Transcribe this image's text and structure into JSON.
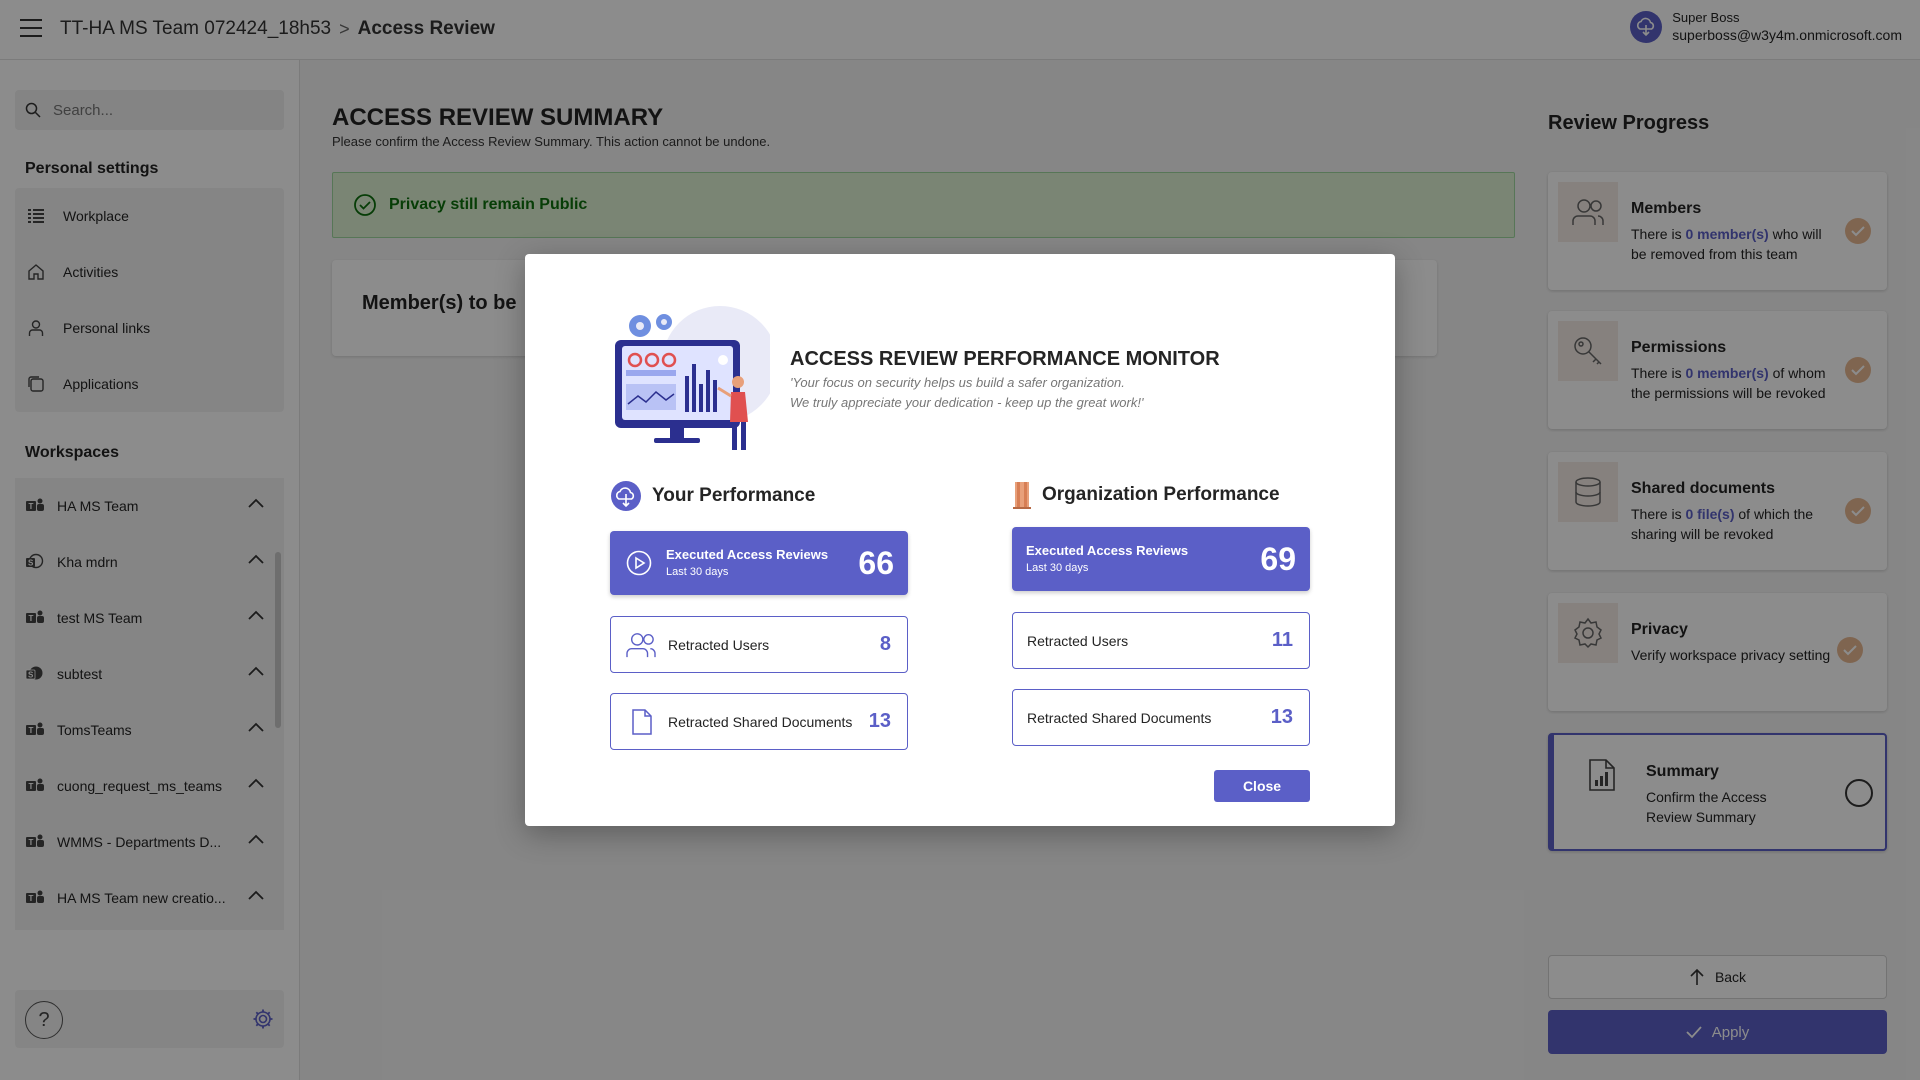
{
  "header": {
    "team_name": "TT-HA MS Team 072424_18h53",
    "separator": ">",
    "page": "Access Review",
    "user_name": "Super Boss",
    "user_email": "superboss@w3y4m.onmicrosoft.com"
  },
  "sidebar": {
    "search_placeholder": "Search...",
    "personal_title": "Personal settings",
    "personal_items": [
      {
        "label": "Workplace",
        "icon": "grid-icon"
      },
      {
        "label": "Activities",
        "icon": "home-icon"
      },
      {
        "label": "Personal links",
        "icon": "person-icon"
      },
      {
        "label": "Applications",
        "icon": "apps-icon"
      }
    ],
    "workspaces_title": "Workspaces",
    "workspaces": [
      "HA MS Team",
      "Kha mdrn",
      "test MS Team",
      "subtest",
      "TomsTeams",
      "cuong_request_ms_teams",
      "WMMS - Departments D...",
      "HA MS Team new creatio..."
    ],
    "help_label": "?"
  },
  "main": {
    "title": "ACCESS REVIEW SUMMARY",
    "subtitle": "Please confirm the Access Review Summary. This action cannot be undone.",
    "alert": "Privacy still remain Public",
    "members_title": "Member(s) to be"
  },
  "progress": {
    "title": "Review Progress",
    "steps": [
      {
        "title": "Members",
        "pre": "There is ",
        "highlight": "0 member(s)",
        "post": " who will be removed from this team"
      },
      {
        "title": "Permissions",
        "pre": "There is ",
        "highlight": "0 member(s)",
        "post": " of whom the permissions will be revoked"
      },
      {
        "title": "Shared documents",
        "pre": "There is ",
        "highlight": "0 file(s)",
        "post": " of which the sharing will be revoked"
      },
      {
        "title": "Privacy",
        "desc": "Verify workspace privacy setting"
      },
      {
        "title": "Summary",
        "desc": "Confirm the Access Review Summary"
      }
    ],
    "back_label": "Back",
    "apply_label": "Apply"
  },
  "modal": {
    "title": "ACCESS REVIEW PERFORMANCE MONITOR",
    "quote_line1": "'Your focus on security helps us build a safer organization.",
    "quote_line2": "We truly appreciate your dedication - keep up the great work!'",
    "your": {
      "heading": "Your Performance",
      "executed_label": "Executed Access Reviews",
      "executed_sub": "Last 30 days",
      "executed_value": "66",
      "users_label": "Retracted Users",
      "users_value": "8",
      "docs_label": "Retracted Shared Documents",
      "docs_value": "13"
    },
    "org": {
      "heading": "Organization Performance",
      "executed_label": "Executed Access Reviews",
      "executed_sub": "Last 30 days",
      "executed_value": "69",
      "users_label": "Retracted Users",
      "users_value": "11",
      "docs_label": "Retracted Shared Documents",
      "docs_value": "13"
    },
    "close_label": "Close"
  },
  "colors": {
    "accent": "#5b5fc7",
    "success_bg": "#dff3d4",
    "success_text": "#0e700e",
    "step_icon_bg": "#f4ece6",
    "check": "#e8b992"
  }
}
